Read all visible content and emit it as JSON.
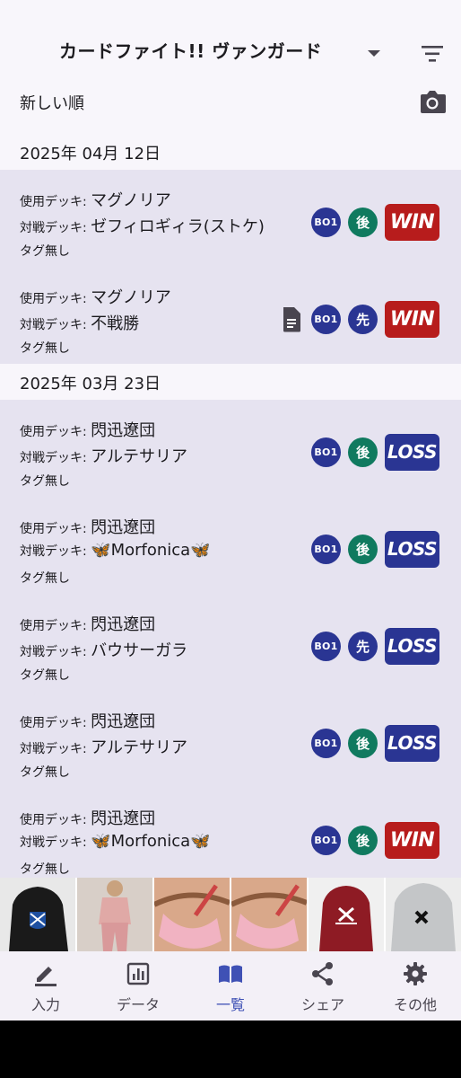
{
  "header": {
    "title": "カードファイト!! ヴァンガード"
  },
  "sort": {
    "label": "新しい順"
  },
  "labels": {
    "used_deck": "使用デッキ: ",
    "opp_deck": "対戦デッキ: "
  },
  "groups": [
    {
      "date": "2025年 04月 12日",
      "matches": [
        {
          "used": "マグノリア",
          "opp": "ゼフィロギィラ(ストケ)",
          "tag": "タグ無し",
          "bo": "BO1",
          "turn": "後",
          "result": "WIN",
          "has_note": false
        },
        {
          "used": "マグノリア",
          "opp": "不戦勝",
          "tag": "タグ無し",
          "bo": "BO1",
          "turn": "先",
          "result": "WIN",
          "has_note": true
        }
      ]
    },
    {
      "date": "2025年 03月 23日",
      "matches": [
        {
          "used": "閃迅遼団",
          "opp": "アルテサリア",
          "tag": "タグ無し",
          "bo": "BO1",
          "turn": "後",
          "result": "LOSS",
          "has_note": false
        },
        {
          "used": "閃迅遼団",
          "opp": "🦋Morfonica🦋",
          "tag": "タグ無し",
          "bo": "BO1",
          "turn": "後",
          "result": "LOSS",
          "has_note": false
        },
        {
          "used": "閃迅遼団",
          "opp": "バウサーガラ",
          "tag": "タグ無し",
          "bo": "BO1",
          "turn": "先",
          "result": "LOSS",
          "has_note": false
        },
        {
          "used": "閃迅遼団",
          "opp": "アルテサリア",
          "tag": "タグ無し",
          "bo": "BO1",
          "turn": "後",
          "result": "LOSS",
          "has_note": false
        },
        {
          "used": "閃迅遼団",
          "opp": "🦋Morfonica🦋",
          "tag": "タグ無し",
          "bo": "BO1",
          "turn": "後",
          "result": "WIN",
          "has_note": false
        }
      ]
    }
  ],
  "nav": [
    {
      "label": "入力",
      "icon": "pencil-icon",
      "active": false
    },
    {
      "label": "データ",
      "icon": "bar-chart-icon",
      "active": false
    },
    {
      "label": "一覧",
      "icon": "book-icon",
      "active": true
    },
    {
      "label": "シェア",
      "icon": "share-icon",
      "active": false
    },
    {
      "label": "その他",
      "icon": "gear-icon",
      "active": false
    }
  ],
  "colors": {
    "win": "#b71c1c",
    "loss": "#2a3593",
    "bo": "#2a3593",
    "turn_second": "#107a5f",
    "turn_first": "#2a3593",
    "accent": "#3f51b5",
    "row_bg": "#e6e3f0"
  }
}
